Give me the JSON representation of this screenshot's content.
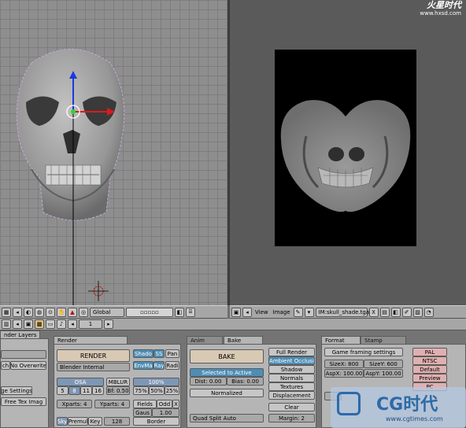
{
  "watermark_top": {
    "cn": "火星时代",
    "url": "www.hxsd.com"
  },
  "watermark_bottom": {
    "logo": "CG时代",
    "url": "www.cgtimes.com"
  },
  "viewport_header": {
    "icons": [
      "window-type-icon",
      "menu-toggle-icon",
      "mode-icon",
      "shading-icon",
      "pivot-icon",
      "hand-icon",
      "translate-icon",
      "rotate-icon"
    ],
    "orientation": "Global"
  },
  "image_header": {
    "menus": [
      "View",
      "Image"
    ],
    "image_name": "IM:skull_shade.tga",
    "close_glyph": "X"
  },
  "buttons_header": {
    "frame": "1"
  },
  "left_panel": {
    "title": "nder Layers",
    "btn1": "ch",
    "btn2": "No Overwrite",
    "btn3": "ge Settings",
    "btn4": "Free Tex Imag"
  },
  "render_panel": {
    "tab": "Render",
    "render": "RENDER",
    "renderer": "Blender Internal",
    "shadow": "Shado",
    "ss": "SS",
    "pan": "Pan",
    "envmap": "EnvMa",
    "ray": "Ray",
    "radio": "Radi",
    "osa": "OSA",
    "osa_levels": [
      "5",
      "8",
      "11",
      "16"
    ],
    "mblur": "MBLUR",
    "bf": "Bf: 0.50",
    "percent_label": "100%",
    "percents": [
      "75%",
      "50%",
      "25%"
    ],
    "xparts": "Xparts: 4",
    "yparts": "Yparts: 4",
    "fields": "Fields",
    "odd": "Odd",
    "x": "X",
    "gauss": "Gaus",
    "gauss_val": "1.00",
    "sky": "Sky",
    "premul": "Premul",
    "key": "Key",
    "bits": "128",
    "border": "Border"
  },
  "bake_panel": {
    "tabs": [
      "Anim",
      "Bake"
    ],
    "bake": "BAKE",
    "selected_to_active": "Selected to Active",
    "dist": "Dist: 0.00",
    "bias": "Bias: 0.00",
    "normalized": "Normalized",
    "modes": [
      "Full Render",
      "Ambient Occlusi",
      "Shadow",
      "Normals",
      "Textures",
      "Displacement"
    ],
    "clear": "Clear",
    "quad": "Quad Split Auto",
    "margin": "Margin: 2"
  },
  "format_panel": {
    "tabs": [
      "Format",
      "Stamp"
    ],
    "game_framing": "Game framing settings",
    "sizex": "SizeX: 800",
    "sizey": "SizeY: 600",
    "aspx": "AspX: 100.00",
    "aspy": "AspY: 100.00",
    "presets": [
      "PAL",
      "NTSC",
      "Default",
      "Preview",
      "PC"
    ]
  }
}
